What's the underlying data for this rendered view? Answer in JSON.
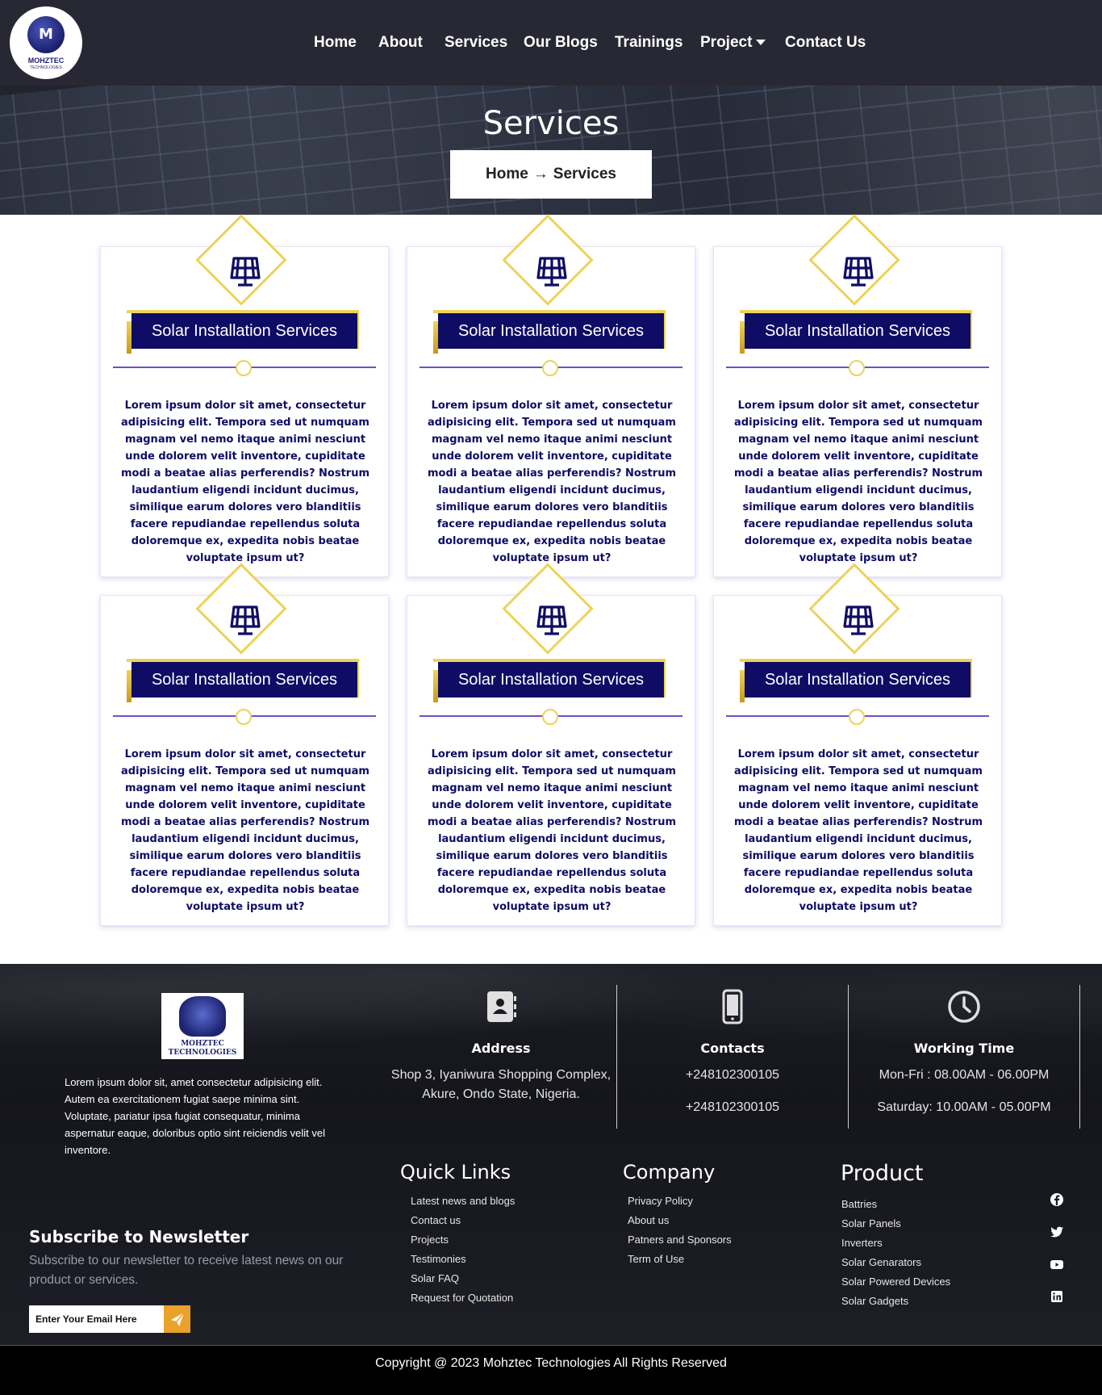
{
  "brand": {
    "logo_text": "MOHZTEC",
    "logo_sub": "TECHNOLOGIES",
    "logo_letter": "M"
  },
  "nav": {
    "items": [
      "Home",
      "About",
      "Services",
      "Our Blogs",
      "Trainings",
      "Project",
      "Contact Us"
    ]
  },
  "hero": {
    "title": "Services",
    "breadcrumb_home": "Home",
    "breadcrumb_arrow": "→",
    "breadcrumb_current": "Services"
  },
  "cards": [
    {
      "icon": "solar-panel-icon",
      "title": "Solar Installation Services",
      "text": "Lorem ipsum dolor sit amet, consectetur adipisicing elit. Tempora sed ut numquam magnam vel nemo itaque animi nesciunt unde dolorem velit inventore, cupiditate modi a beatae alias perferendis? Nostrum laudantium eligendi incidunt ducimus, similique earum dolores vero blanditiis facere repudiandae repellendus soluta doloremque ex, expedita nobis beatae voluptate ipsum ut?"
    },
    {
      "icon": "solar-panel-icon",
      "title": "Solar Installation Services",
      "text": "Lorem ipsum dolor sit amet, consectetur adipisicing elit. Tempora sed ut numquam magnam vel nemo itaque animi nesciunt unde dolorem velit inventore, cupiditate modi a beatae alias perferendis? Nostrum laudantium eligendi incidunt ducimus, similique earum dolores vero blanditiis facere repudiandae repellendus soluta doloremque ex, expedita nobis beatae voluptate ipsum ut?"
    },
    {
      "icon": "solar-panel-icon",
      "title": "Solar Installation Services",
      "text": "Lorem ipsum dolor sit amet, consectetur adipisicing elit. Tempora sed ut numquam magnam vel nemo itaque animi nesciunt unde dolorem velit inventore, cupiditate modi a beatae alias perferendis? Nostrum laudantium eligendi incidunt ducimus, similique earum dolores vero blanditiis facere repudiandae repellendus soluta doloremque ex, expedita nobis beatae voluptate ipsum ut?"
    },
    {
      "icon": "solar-panel-icon",
      "title": "Solar Installation Services",
      "text": "Lorem ipsum dolor sit amet, consectetur adipisicing elit. Tempora sed ut numquam magnam vel nemo itaque animi nesciunt unde dolorem velit inventore, cupiditate modi a beatae alias perferendis? Nostrum laudantium eligendi incidunt ducimus, similique earum dolores vero blanditiis facere repudiandae repellendus soluta doloremque ex, expedita nobis beatae voluptate ipsum ut?"
    },
    {
      "icon": "solar-panel-icon",
      "title": "Solar Installation Services",
      "text": "Lorem ipsum dolor sit amet, consectetur adipisicing elit. Tempora sed ut numquam magnam vel nemo itaque animi nesciunt unde dolorem velit inventore, cupiditate modi a beatae alias perferendis? Nostrum laudantium eligendi incidunt ducimus, similique earum dolores vero blanditiis facere repudiandae repellendus soluta doloremque ex, expedita nobis beatae voluptate ipsum ut?"
    },
    {
      "icon": "solar-panel-icon",
      "title": "Solar Installation Services",
      "text": "Lorem ipsum dolor sit amet, consectetur adipisicing elit. Tempora sed ut numquam magnam vel nemo itaque animi nesciunt unde dolorem velit inventore, cupiditate modi a beatae alias perferendis? Nostrum laudantium eligendi incidunt ducimus, similique earum dolores vero blanditiis facere repudiandae repellendus soluta doloremque ex, expedita nobis beatae voluptate ipsum ut?"
    }
  ],
  "footer": {
    "logo_text_1": "MOHZTEC",
    "logo_text_2": "TECHNOLOGIES",
    "about": "Lorem ipsum dolor sit, amet consectetur adipisicing elit. Autem ea exercitationem fugiat saepe minima sint. Voluptate, pariatur ipsa fugiat consequatur, minima aspernatur eaque, doloribus optio sint reiciendis velit vel inventore.",
    "address": {
      "icon": "address-book-icon",
      "title": "Address",
      "line": "Shop 3, Iyaniwura Shopping Complex, Akure, Ondo State, Nigeria."
    },
    "contacts": {
      "icon": "mobile-phone-icon",
      "title": "Contacts",
      "phone1": "+248102300105",
      "phone2": "+248102300105"
    },
    "working": {
      "icon": "clock-icon",
      "title": "Working Time",
      "weekdays": "Mon-Fri : 08.00AM - 06.00PM",
      "saturday": "Saturday: 10.00AM - 05.00PM"
    },
    "newsletter": {
      "title": "Subscribe to Newsletter",
      "description": "Subscribe to our newsletter to receive latest news on our product or services.",
      "placeholder": "Enter Your Email Here",
      "button_icon": "send-icon"
    },
    "quick_links": {
      "title": "Quick Links",
      "items": [
        "Latest news and blogs",
        "Contact us",
        "Projects",
        "Testimonies",
        "Solar FAQ",
        "Request for Quotation"
      ]
    },
    "company": {
      "title": "Company",
      "items": [
        "Privacy Policy",
        "About us",
        "Patners and Sponsors",
        "Term of Use"
      ]
    },
    "product": {
      "title": "Product",
      "items": [
        "Battries",
        "Solar Panels",
        "Inverters",
        "Solar Genarators",
        "Solar Powered Devices",
        "Solar Gadgets"
      ]
    },
    "social": [
      "facebook-icon",
      "twitter-icon",
      "youtube-icon",
      "linkedin-icon"
    ],
    "copyright": "Copyright @ 2023 Mohztec Technologies All Rights Reserved"
  },
  "colors": {
    "nav_bg": "#272833",
    "accent_navy": "#0f0c66",
    "accent_gold": "#ecd35a",
    "divider_purple": "#6a52c4",
    "send_button": "#eaa22d"
  }
}
